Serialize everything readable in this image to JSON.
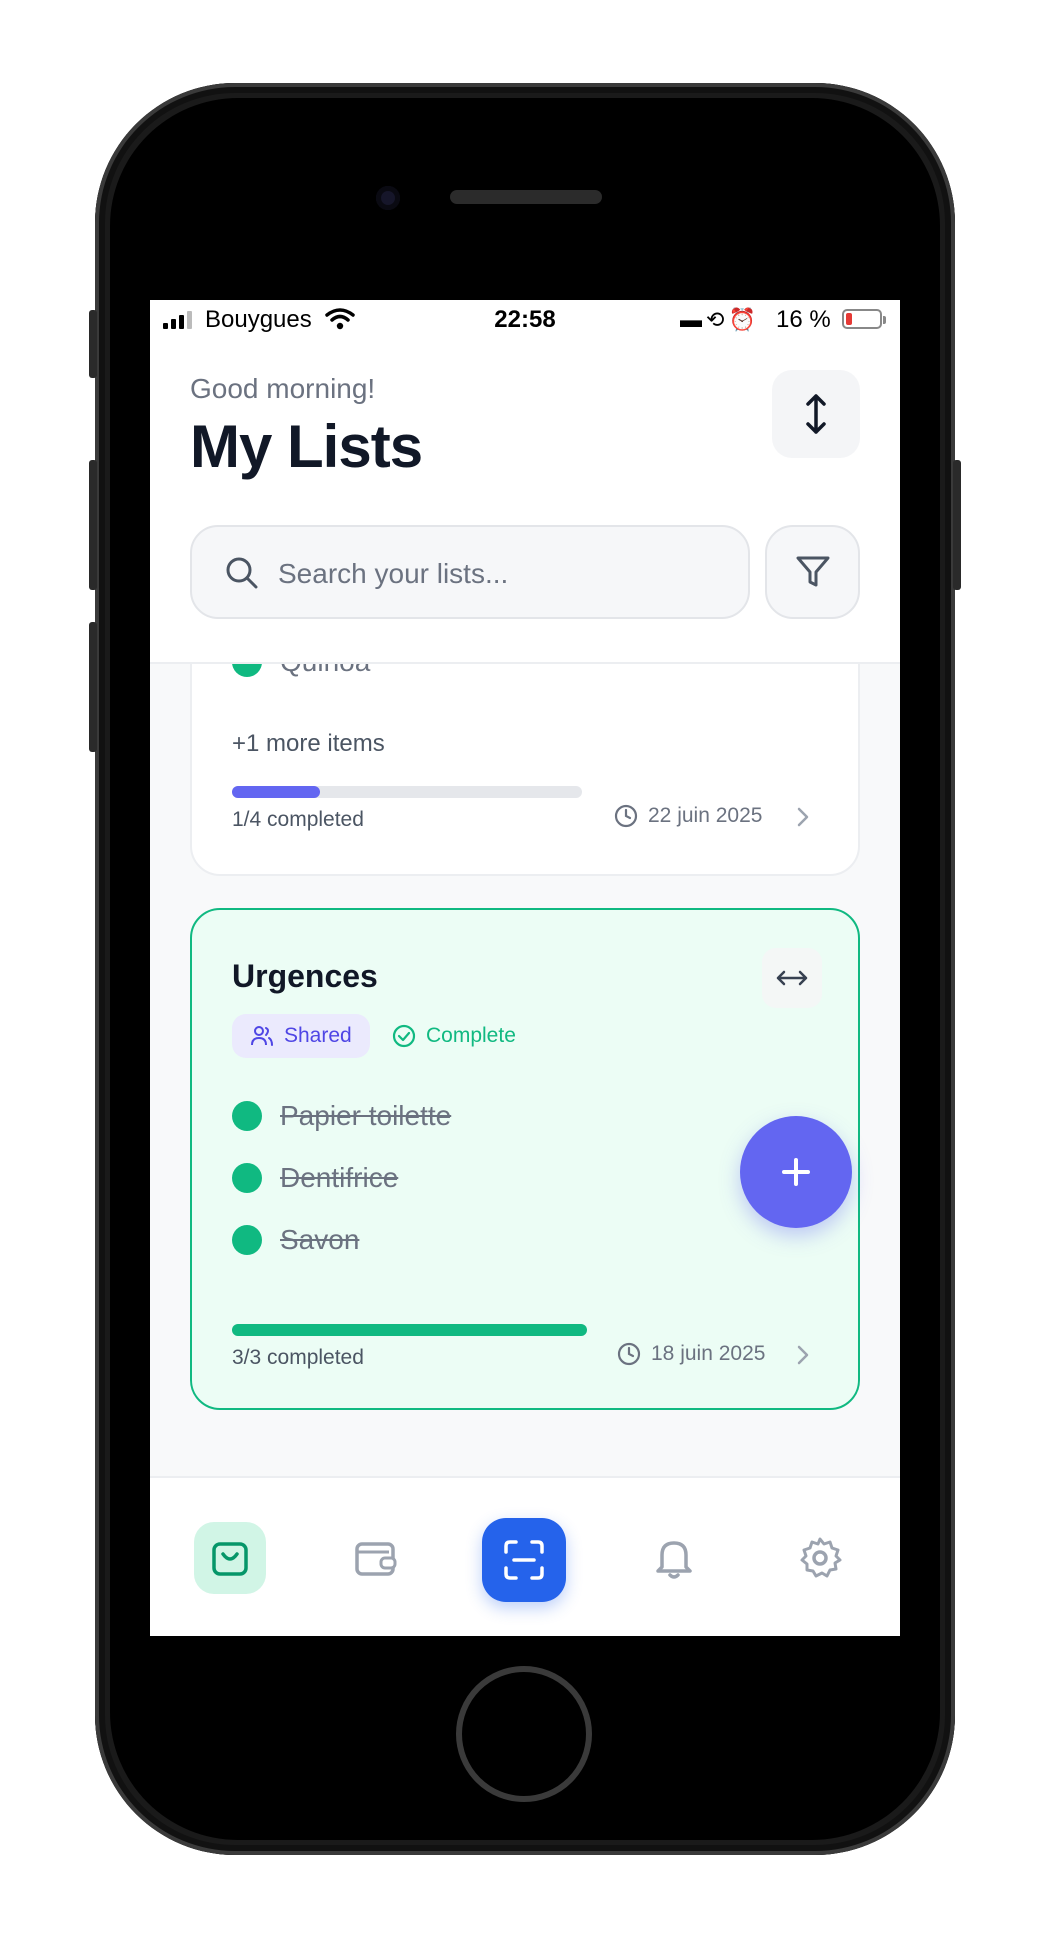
{
  "status_bar": {
    "carrier": "Bouygues",
    "time": "22:58",
    "battery_percent": "16 %"
  },
  "header": {
    "greeting": "Good morning!",
    "title": "My Lists"
  },
  "search": {
    "placeholder": "Search your lists..."
  },
  "lists": [
    {
      "visible_items": [
        {
          "label": "Quinoa",
          "checked": true
        }
      ],
      "more_items": "+1 more items",
      "progress": {
        "label": "1/4 completed",
        "fraction": 0.25,
        "color": "#6366f1"
      },
      "date": "22 juin 2025"
    },
    {
      "name": "Urgences",
      "badges": {
        "shared": "Shared",
        "status": "Complete"
      },
      "items": [
        {
          "label": "Papier toilette",
          "checked": true
        },
        {
          "label": "Dentifrice",
          "checked": true
        },
        {
          "label": "Savon",
          "checked": true
        }
      ],
      "progress": {
        "label": "3/3 completed",
        "fraction": 1.0,
        "color": "#10b981"
      },
      "date": "18 juin 2025"
    }
  ],
  "tabs": [
    {
      "icon": "shopping-bag-icon",
      "active": true
    },
    {
      "icon": "wallet-icon",
      "active": false
    },
    {
      "icon": "scan-icon",
      "active": false
    },
    {
      "icon": "bell-icon",
      "active": false
    },
    {
      "icon": "gear-icon",
      "active": false
    }
  ],
  "colors": {
    "accent": "#6366f1",
    "success": "#10b981",
    "scan": "#2563eb"
  }
}
